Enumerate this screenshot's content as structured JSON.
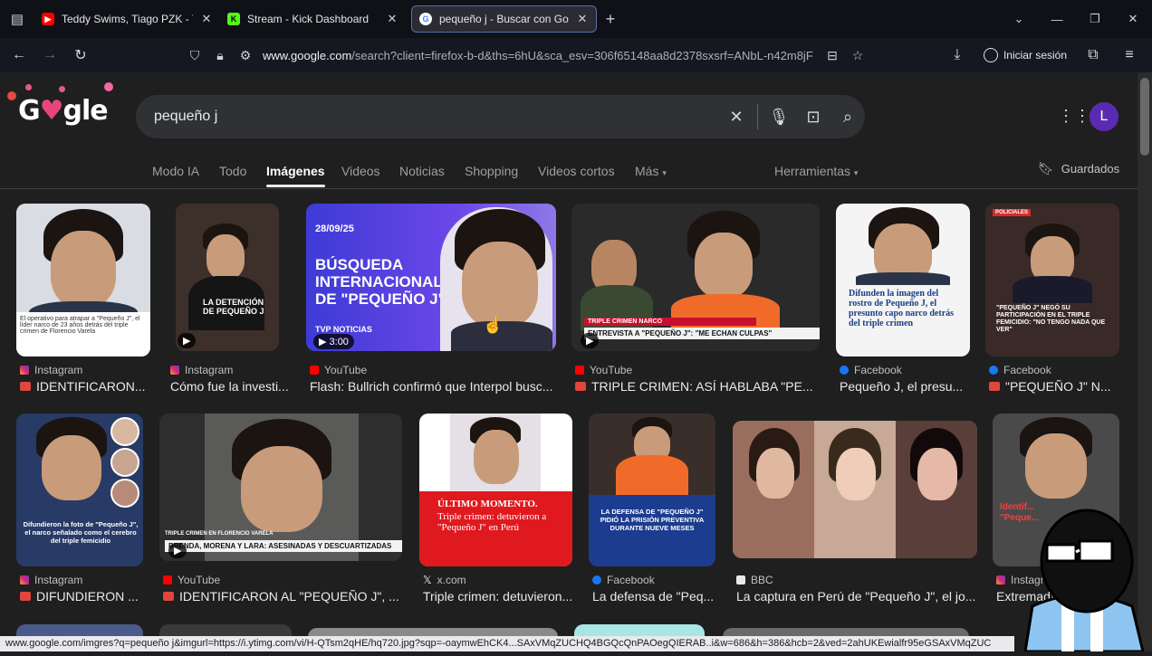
{
  "browser": {
    "tabs": [
      {
        "title": "Teddy Swims, Tiago PZK - The L",
        "favicon": "youtube-icon",
        "color": "#ff0000"
      },
      {
        "title": "Stream - Kick Dashboard",
        "favicon": "kick-icon",
        "color": "#53fc18"
      },
      {
        "title": "pequeño j - Buscar con Google",
        "favicon": "google-icon",
        "color": "#ffffff"
      }
    ],
    "url_domain": "www.google.com",
    "url_rest": "/search?client=firefox-b-d&ths=6hU&sca_esv=306f65148aa8d2378sxsrf=ANbL-n42m8jF",
    "signin_label": "Iniciar sesión"
  },
  "google": {
    "query": "pequeño j",
    "avatar_letter": "L",
    "tabs": [
      "Modo IA",
      "Todo",
      "Imágenes",
      "Videos",
      "Noticias",
      "Shopping",
      "Videos cortos",
      "Más"
    ],
    "active_tab": "Imágenes",
    "tools_label": "Herramientas",
    "saved_label": "Guardados"
  },
  "results": [
    {
      "source": "Instagram",
      "caption": "IDENTIFICARON...",
      "overlay": "El operativo para atrapar a \"Pequeño J\", el líder narco de 23 años detrás del triple crimen de Florencio Varela"
    },
    {
      "source": "Instagram",
      "caption": "Cómo fue la investi...",
      "overlay": "LA DETENCIÓN DE PEQUEÑO J"
    },
    {
      "source": "YouTube",
      "caption": "Flash: Bullrich confirmó que Interpol busc...",
      "overlay_date": "28/09/25",
      "overlay": "BÚSQUEDA INTERNACIONAL DE \"PEQUEÑO J\"",
      "overlay_brand": "TVP NOTICIAS",
      "duration": "3:00"
    },
    {
      "source": "YouTube",
      "caption": "TRIPLE CRIMEN: ASÍ HABLABA \"PE...",
      "overlay": "ENTREVISTA A \"PEQUEÑO J\": \"ME ECHAN CULPAS\"",
      "overlay_top": "TRIPLE CRIMEN NARCO"
    },
    {
      "source": "Facebook",
      "caption": "Pequeño J, el presu...",
      "overlay": "Difunden la imagen del rostro de Pequeño J, el presunto capo narco detrás del triple crimen"
    },
    {
      "source": "Facebook",
      "caption": "\"PEQUEÑO J\" N...",
      "overlay": "\"PEQUEÑO J\" NEGÓ SU PARTICIPACIÓN EN EL TRIPLE FEMICIDIO: \"NO TENGO NADA QUE VER\"",
      "overlay_tag": "POLICIALES"
    },
    {
      "source": "Instagram",
      "caption": "DIFUNDIERON ...",
      "overlay": "Difundieron la foto de \"Pequeño J\", el narco señalado como el cerebro del triple femicidio"
    },
    {
      "source": "YouTube",
      "caption": "IDENTIFICARON AL \"PEQUEÑO J\", ...",
      "overlay": "BRENDA, MORENA Y LARA: ASESINADAS Y DESCUARTIZADAS",
      "overlay_top": "TRIPLE CRIMEN EN FLORENCIO VARELA"
    },
    {
      "source": "x.com",
      "caption": "Triple crimen: detuvieron...",
      "overlay_title": "ÚLTIMO MOMENTO.",
      "overlay": "Triple crimen: detuvieron a \"Pequeño J\" en Perú"
    },
    {
      "source": "Facebook",
      "caption": "La defensa de \"Peq...",
      "overlay": "LA DEFENSA DE \"PEQUEÑO J\" PIDIÓ LA PRISIÓN PREVENTIVA DURANTE NUEVE MESES"
    },
    {
      "source": "BBC",
      "caption": "La captura en Perú de \"Pequeño J\", el jo..."
    },
    {
      "source": "Instagram",
      "caption": "Extremada...",
      "overlay": "Identif... \"Peque..."
    }
  ],
  "status_url": "www.google.com/imgres?q=pequeño j&imgurl=https://i.ytimg.com/vi/H-QTsm2qHE/hq720.jpg?sqp=-oaymwEhCK4...SAxVMqZUCHQ4BGQcQnPAOegQIERAB..i&w=686&h=386&hcb=2&ved=2ahUKEwialfr95eGSAxVMqZUC"
}
